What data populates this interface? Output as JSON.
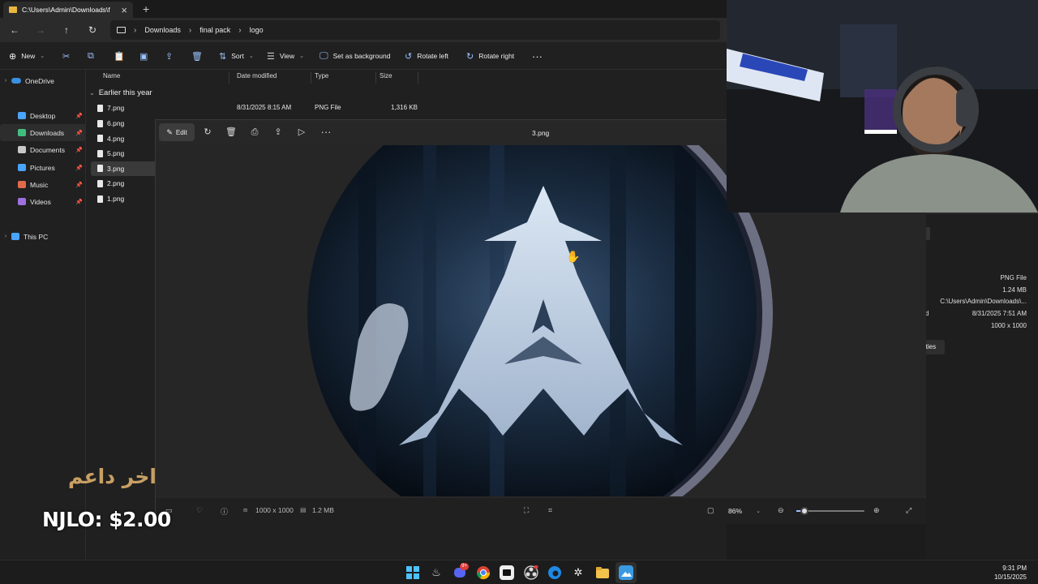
{
  "explorer": {
    "tab_title": "C:\\Users\\Admin\\Downloads\\f",
    "breadcrumbs": [
      "Downloads",
      "final pack",
      "logo"
    ],
    "commands": {
      "new": "New",
      "sort": "Sort",
      "view": "View",
      "set_background": "Set as background",
      "rotate_left": "Rotate left",
      "rotate_right": "Rotate right"
    },
    "sidebar": {
      "onedrive": "OneDrive",
      "items": [
        {
          "label": "Desktop",
          "icon": "desktop-icon",
          "color": "#4aa3ff"
        },
        {
          "label": "Downloads",
          "icon": "download-icon",
          "color": "#3fbf7f"
        },
        {
          "label": "Documents",
          "icon": "document-icon",
          "color": "#c8c8c8"
        },
        {
          "label": "Pictures",
          "icon": "picture-icon",
          "color": "#4aa3ff"
        },
        {
          "label": "Music",
          "icon": "music-icon",
          "color": "#e06a4a"
        },
        {
          "label": "Videos",
          "icon": "video-icon",
          "color": "#a070e0"
        }
      ],
      "this_pc": "This PC"
    },
    "columns": [
      "Name",
      "Date modified",
      "Type",
      "Size"
    ],
    "group_label": "Earlier this year",
    "first_row": {
      "name": "7.png",
      "date": "8/31/2025 8:15 AM",
      "type": "PNG File",
      "size": "1,316 KB"
    },
    "files": [
      "6.png",
      "4.png",
      "5.png",
      "3.png",
      "2.png",
      "1.png"
    ],
    "selected_file": "3.png"
  },
  "viewer": {
    "edit_label": "Edit",
    "title": "3.png",
    "dimensions": "1000 x 1000",
    "filesize": "1.2 MB",
    "zoom": "86%",
    "zoom_level": 0.12
  },
  "details": {
    "type": "PNG File",
    "size": "1.24 MB",
    "path": "C:\\Users\\Admin\\Downloads\\...",
    "date_label_fragment": "d",
    "date": "8/31/2025 7:51 AM",
    "dimensions": "1000 x 1000",
    "properties_fragment": "rties"
  },
  "overlay": {
    "arabic_text": "اخر داعم",
    "donation": "NJLO: $2.00"
  },
  "taskbar": {
    "time": "9:31 PM",
    "date": "10/15/2025",
    "discord_badge": "9+"
  }
}
